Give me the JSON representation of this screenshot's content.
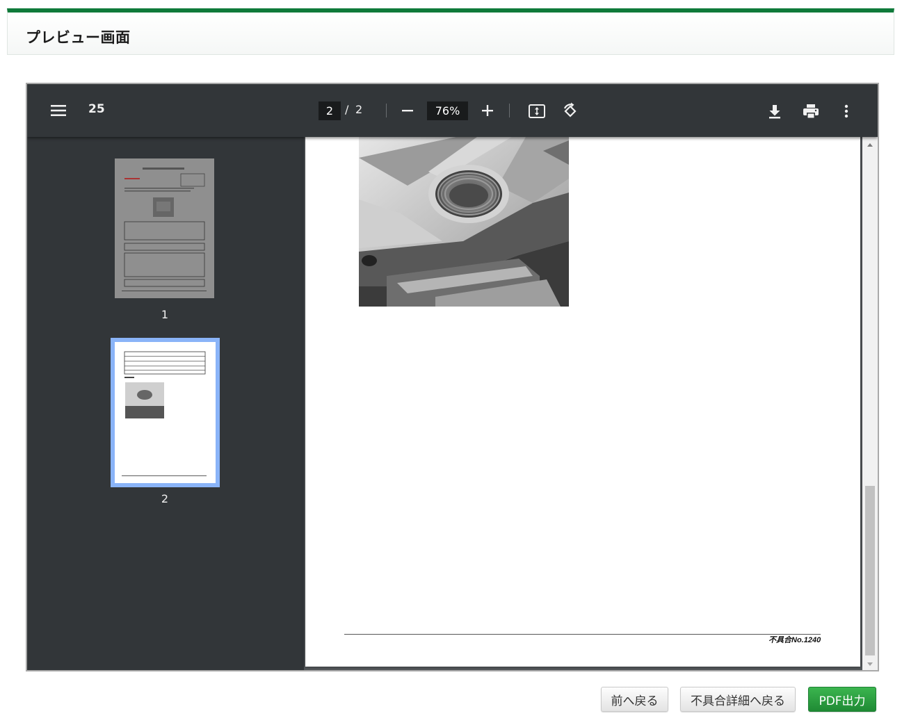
{
  "header": {
    "title": "プレビュー画面"
  },
  "viewer": {
    "doc_title": "25",
    "current_page": "2",
    "page_separator": "/",
    "total_pages": "2",
    "zoom": "76%",
    "thumbnails": [
      {
        "label": "1"
      },
      {
        "label": "2",
        "selected": true
      }
    ],
    "page_footer": "不具合No.1240",
    "icons": [
      "menu-icon",
      "zoom-out-icon",
      "zoom-in-icon",
      "fit-page-icon",
      "rotate-icon",
      "download-icon",
      "print-icon",
      "more-vert-icon"
    ]
  },
  "buttons": {
    "back": "前へ戻る",
    "detail": "不具合詳細へ戻る",
    "pdf": "PDF出力"
  },
  "colors": {
    "header_accent": "#0f7a3a",
    "toolbar_bg": "#323639",
    "selected_thumb": "#8ab4f8",
    "pdf_button": "#2a9a41"
  }
}
